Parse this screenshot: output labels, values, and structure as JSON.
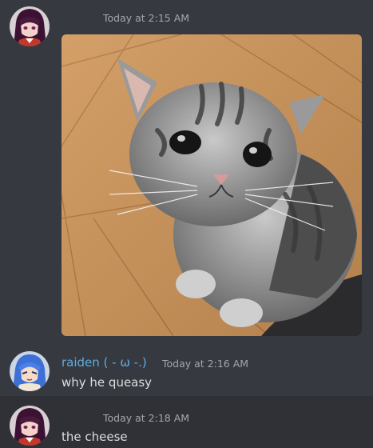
{
  "messages": [
    {
      "author": "",
      "author_color": "#8e3bb8",
      "timestamp": "Today at 2:15 AM",
      "attachment": "cat-photo",
      "text": ""
    },
    {
      "author": "raiden ( - ω -.)",
      "author_color": "#5dade2",
      "timestamp": "Today at 2:16 AM",
      "text": "why he queasy"
    },
    {
      "author": "",
      "author_color": "#8e3bb8",
      "timestamp": "Today at 2:18 AM",
      "text": "the cheese"
    }
  ],
  "colors": {
    "background": "#36393f",
    "text": "#dcddde",
    "timestamp": "#a3a6aa"
  }
}
